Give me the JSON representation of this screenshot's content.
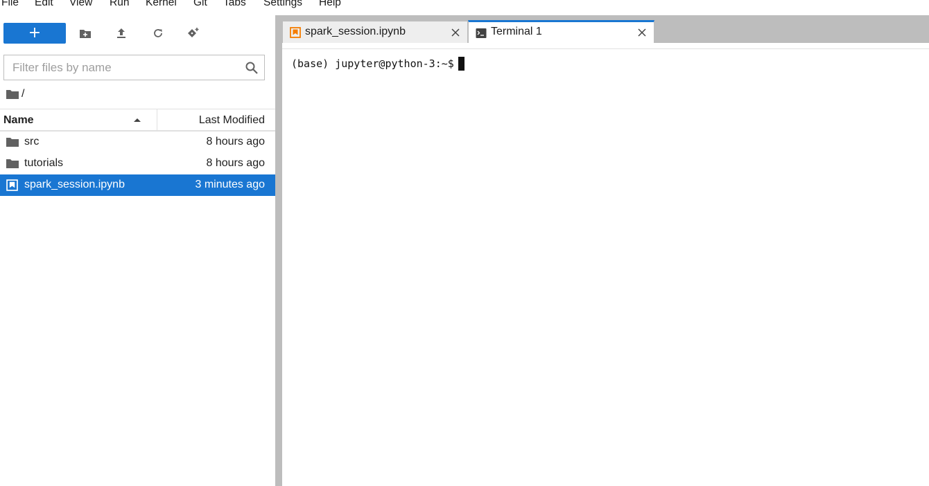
{
  "menubar": {
    "items": [
      "File",
      "Edit",
      "View",
      "Run",
      "Kernel",
      "Git",
      "Tabs",
      "Settings",
      "Help"
    ]
  },
  "sidebar": {
    "toolbar": {
      "new_label": "+",
      "icons": [
        "new-folder-icon",
        "upload-icon",
        "refresh-icon",
        "git-clone-icon"
      ]
    },
    "filter": {
      "placeholder": "Filter files by name",
      "value": ""
    },
    "breadcrumb": "/",
    "columns": {
      "name": "Name",
      "modified": "Last Modified"
    },
    "files": [
      {
        "name": "src",
        "modified": "8 hours ago",
        "type": "folder",
        "selected": false
      },
      {
        "name": "tutorials",
        "modified": "8 hours ago",
        "type": "folder",
        "selected": false
      },
      {
        "name": "spark_session.ipynb",
        "modified": "3 minutes ago",
        "type": "notebook",
        "selected": true
      }
    ]
  },
  "tabs": [
    {
      "label": "spark_session.ipynb",
      "icon": "notebook-icon",
      "active": false
    },
    {
      "label": "Terminal 1",
      "icon": "terminal-icon",
      "active": true
    }
  ],
  "terminal": {
    "prompt": "(base) jupyter@python-3:~$ "
  },
  "colors": {
    "accent": "#1976d2",
    "notebook_orange": "#f57c00",
    "splitter": "#bdbdbd"
  }
}
